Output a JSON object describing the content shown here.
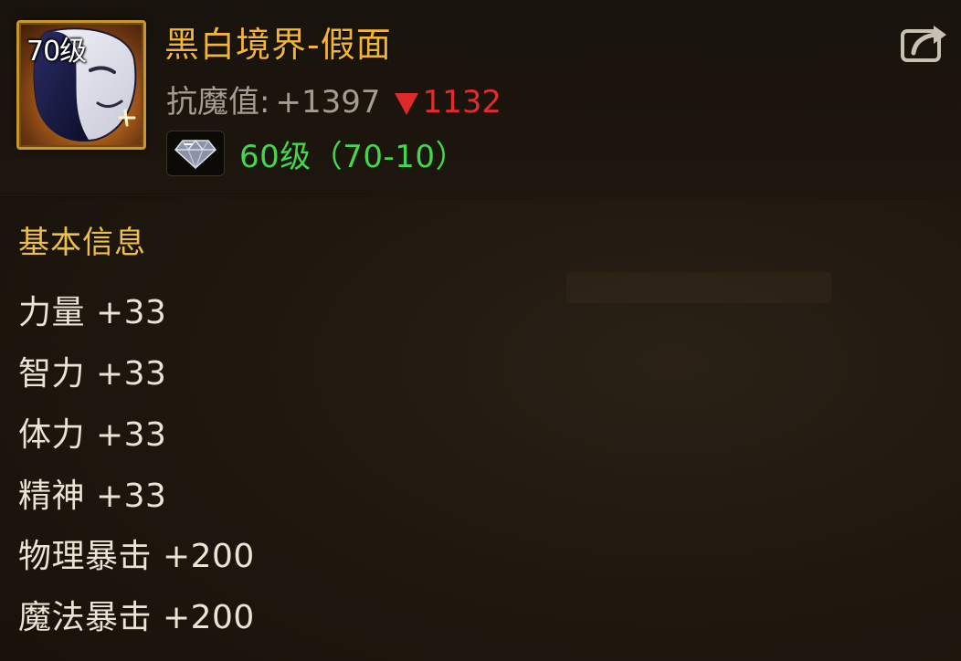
{
  "item": {
    "level_badge": "70级",
    "name": "黑白境界-假面",
    "resist_label": "抗魔值:",
    "resist_value": "+1397",
    "resist_delta": "1132",
    "gem_text": "60级（70-10）"
  },
  "section": {
    "title": "基本信息"
  },
  "stats": [
    {
      "label": "力量 +33"
    },
    {
      "label": "智力 +33"
    },
    {
      "label": "体力 +33"
    },
    {
      "label": "精神 +33"
    },
    {
      "label": "物理暴击 +200"
    },
    {
      "label": "魔法暴击 +200"
    }
  ],
  "icons": {
    "item": "mask-icon",
    "share": "share-icon",
    "gem": "diamond-gem-icon",
    "delta": "down-triangle-icon"
  },
  "colors": {
    "title": "#f3b634",
    "section": "#eebf4a",
    "gem_text": "#44d64b",
    "delta": "#e12c2c",
    "stat_text": "#ece3d3",
    "icon_border": "#c9962e"
  }
}
